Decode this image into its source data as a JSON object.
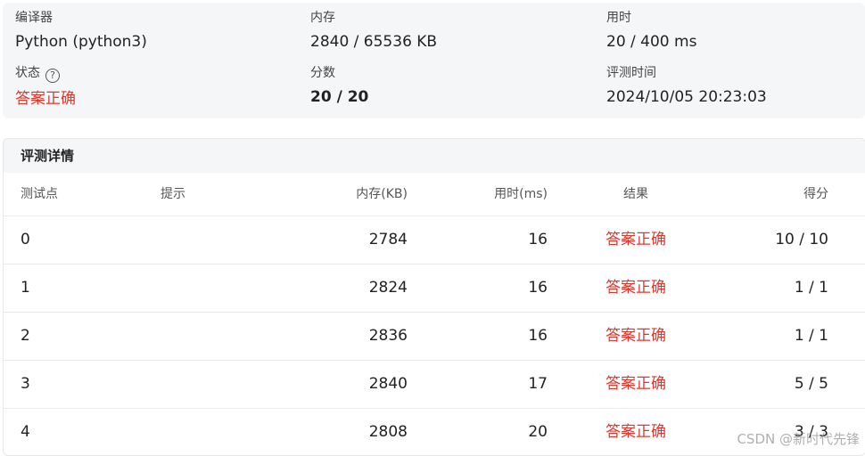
{
  "summary": {
    "compiler": {
      "label": "编译器",
      "value": "Python (python3)"
    },
    "memory": {
      "label": "内存",
      "value": "2840 / 65536 KB"
    },
    "time_used": {
      "label": "用时",
      "value": "20 / 400 ms"
    },
    "status": {
      "label": "状态",
      "help_icon": "?",
      "value": "答案正确"
    },
    "score": {
      "label": "分数",
      "value": "20 / 20"
    },
    "judge_time": {
      "label": "评测时间",
      "value": "2024/10/05 20:23:03"
    }
  },
  "details": {
    "title": "评测详情",
    "columns": [
      "测试点",
      "提示",
      "内存(KB)",
      "用时(ms)",
      "结果",
      "得分"
    ],
    "rows": [
      {
        "index": "0",
        "hint": "",
        "memory": "2784",
        "time": "16",
        "result": "答案正确",
        "score": "10 / 10"
      },
      {
        "index": "1",
        "hint": "",
        "memory": "2824",
        "time": "16",
        "result": "答案正确",
        "score": "1 / 1"
      },
      {
        "index": "2",
        "hint": "",
        "memory": "2836",
        "time": "16",
        "result": "答案正确",
        "score": "1 / 1"
      },
      {
        "index": "3",
        "hint": "",
        "memory": "2840",
        "time": "17",
        "result": "答案正确",
        "score": "5 / 5"
      },
      {
        "index": "4",
        "hint": "",
        "memory": "2808",
        "time": "20",
        "result": "答案正确",
        "score": "3 / 3"
      }
    ]
  },
  "watermark": "CSDN @新时代先锋",
  "colors": {
    "accepted": "#e5352b",
    "panel_bg": "#f5f6f8"
  }
}
